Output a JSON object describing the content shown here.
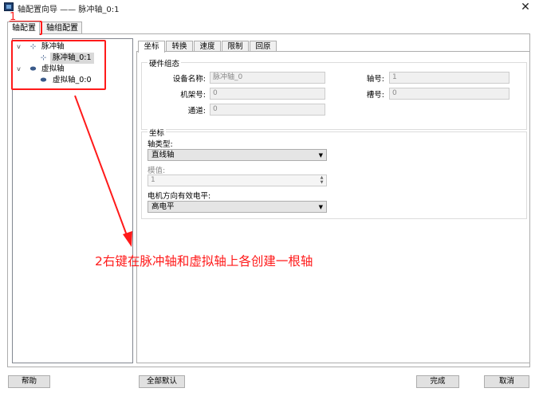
{
  "window": {
    "title": "轴配置向导 —— 脉冲轴_0:1",
    "close_glyph": "✕"
  },
  "outer_tabs": [
    "轴配置",
    "轴组配置"
  ],
  "tree": {
    "groups": [
      {
        "label": "脉冲轴",
        "icon": "pulse-axis-icon",
        "expander": "v",
        "child": "脉冲轴_0:1",
        "child_selected": true
      },
      {
        "label": "虚拟轴",
        "icon": "virtual-axis-icon",
        "expander": "v",
        "child": "虚拟轴_0:0",
        "child_selected": false
      }
    ]
  },
  "inner_tabs": [
    "坐标",
    "转换",
    "速度",
    "限制",
    "回原"
  ],
  "hardware_group": {
    "title": "硬件组态",
    "device_name_label": "设备名称:",
    "device_name_value": "脉冲轴_0",
    "rack_label": "机架号:",
    "rack_value": "0",
    "channel_label": "通道:",
    "channel_value": "0",
    "axis_no_label": "轴号:",
    "axis_no_value": "1",
    "slot_label": "槽号:",
    "slot_value": "0"
  },
  "coord_group": {
    "title": "坐标",
    "axis_type_label": "轴类型:",
    "axis_type_value": "直线轴",
    "modulo_label": "模值:",
    "modulo_value": "1",
    "motor_level_label": "电机方向有效电平:",
    "motor_level_value": "高电平",
    "combo_arrow": "▼"
  },
  "buttons": {
    "help": "帮助",
    "defaults": "全部默认",
    "finish": "完成",
    "cancel": "取消"
  },
  "annotation": {
    "step1": "1",
    "step2": "2右键在脉冲轴和虚拟轴上各创建一根轴",
    "color": "#ff1a1a"
  }
}
